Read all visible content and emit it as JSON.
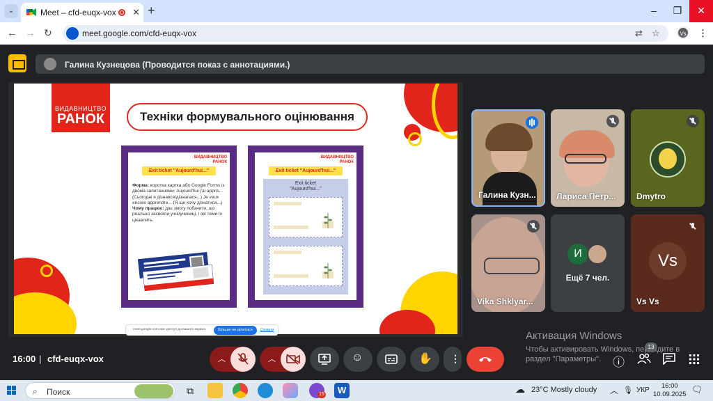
{
  "browser": {
    "tab_title": "Meet – cfd-euqx-vox",
    "new_tab": "+",
    "url": "meet.google.com/cfd-euqx-vox",
    "profile_initials": "Vs",
    "window_buttons": [
      "–",
      "❐",
      "✕"
    ]
  },
  "meet": {
    "presenter_banner": "Галина Кузнецова (Проводится показ с аннотациями.)",
    "clock": "16:00",
    "separator": "|",
    "meeting_code": "cfd-euqx-vox",
    "people_count": "13"
  },
  "slide": {
    "logo_top": "ВИДАВНИЦТВО",
    "logo_main": "РАНОК",
    "title": "Техніки формувального оцінювання",
    "card_left": {
      "mini_logo": "ВИДАВНИЦТВО\nРАНОК",
      "pill": "Exit ticket \"Aujourd'hui...\"",
      "form_label": "Форма:",
      "form_text": " коротка картка або Google Forms із двома запитаннями: Aujourd'hui j'ai appris... (Сьогодні я дізнався/дізналася...) Je veux encore apprendre... (Я ще хочу дізнатися...)",
      "why_label": "Чому працює:",
      "why_text": " дає змогу побачити, що реально засвоїли учні/учениці, і які теми їх цікавлять."
    },
    "card_right": {
      "mini_logo": "ВИДАВНИЦТВО\nРАНОК",
      "pill": "Exit ticket \"Aujourd'hui...\"",
      "panel_title": "Exit ticket\n\"Aujourd'hui...\""
    },
    "share_bar": {
      "text": "meet.google.com має доступ до вашого екрана.",
      "stop": "Більше не ділитися",
      "hide": "Сховати"
    }
  },
  "participants": [
    {
      "name": "Галина Кузн...",
      "status": "speaking"
    },
    {
      "name": "Лариса Петр...",
      "status": "muted"
    },
    {
      "name": "Dmytro",
      "status": "muted"
    },
    {
      "name": "Vika Shklyar...",
      "status": "muted"
    },
    {
      "name": "Ещё 7 чел.",
      "avatar_letter": "И"
    },
    {
      "name": "Vs Vs",
      "avatar_letter": "Vs",
      "status": "muted"
    }
  ],
  "activation": {
    "title": "Активация Windows",
    "line1": "Чтобы активировать Windows, перейдите в",
    "line2": "раздел \"Параметры\"."
  },
  "taskbar": {
    "search_label": "Поиск",
    "weather": "23°C  Mostly cloudy",
    "lang": "УКР",
    "time": "16:00",
    "date": "10.09.2025",
    "mail_badge": "15"
  },
  "colors": {
    "accent_red": "#e1251b",
    "meet_blue": "#1a73e8",
    "hangup": "#ea4335"
  }
}
